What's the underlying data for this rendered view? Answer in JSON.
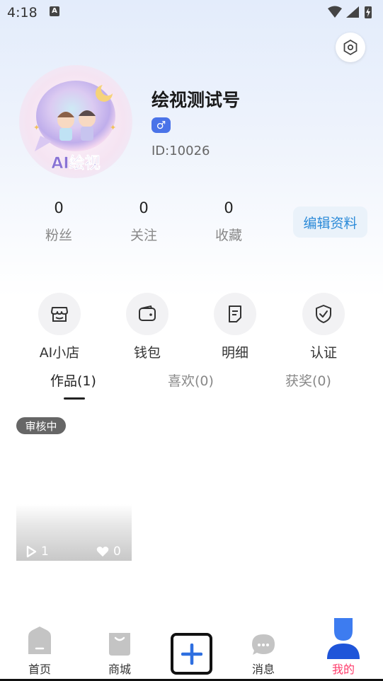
{
  "status_bar": {
    "time": "4:18",
    "keyboard_indicator": "A",
    "icons": [
      "wifi-icon",
      "signal-icon",
      "battery-charging-icon"
    ]
  },
  "profile": {
    "username": "绘视测试号",
    "gender_symbol": "♂",
    "user_id": "ID:10026",
    "avatar_text": "AI绘视"
  },
  "stats": [
    {
      "value": "0",
      "label": "粉丝"
    },
    {
      "value": "0",
      "label": "关注"
    },
    {
      "value": "0",
      "label": "收藏"
    }
  ],
  "edit_profile_label": "编辑资料",
  "features": [
    {
      "label": "AI小店",
      "icon": "store-icon"
    },
    {
      "label": "钱包",
      "icon": "wallet-icon"
    },
    {
      "label": "明细",
      "icon": "document-icon"
    },
    {
      "label": "认证",
      "icon": "shield-check-icon"
    }
  ],
  "tabs": [
    {
      "label": "作品(1)",
      "active": true
    },
    {
      "label": "喜欢(0)",
      "active": false
    },
    {
      "label": "获奖(0)",
      "active": false
    }
  ],
  "works": [
    {
      "status": "审核中",
      "plays": "1",
      "likes": "0"
    }
  ],
  "bottom_nav": [
    {
      "label": "首页",
      "icon": "home-icon",
      "active": false
    },
    {
      "label": "商城",
      "icon": "shopping-bag-icon",
      "active": false
    },
    {
      "label": "",
      "icon": "plus-icon",
      "active": false
    },
    {
      "label": "消息",
      "icon": "chat-bubble-icon",
      "active": false
    },
    {
      "label": "我的",
      "icon": "person-icon",
      "active": true
    }
  ],
  "colors": {
    "accent_blue": "#4a73e8",
    "edit_text": "#2b8ad8",
    "active_nav": "#ff3b6b"
  }
}
